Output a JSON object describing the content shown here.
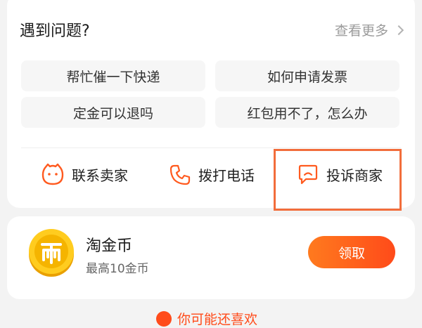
{
  "help": {
    "title": "遇到问题?",
    "see_more": "查看更多",
    "faqs": [
      "帮忙催一下快递",
      "如何申请发票",
      "定金可以退吗",
      "红包用不了，怎么办"
    ],
    "actions": {
      "contact_seller": "联系卖家",
      "call": "拨打电话",
      "complain_merchant": "投诉商家"
    }
  },
  "coins": {
    "title": "淘金币",
    "subtitle": "最高10金币",
    "claim_label": "领取"
  },
  "bottom": {
    "partial_text": "你可能还喜欢"
  },
  "colors": {
    "accent_orange": "#ff5a1f",
    "highlight_box": "#f26d3b",
    "coin_gold": "#f5b400"
  }
}
